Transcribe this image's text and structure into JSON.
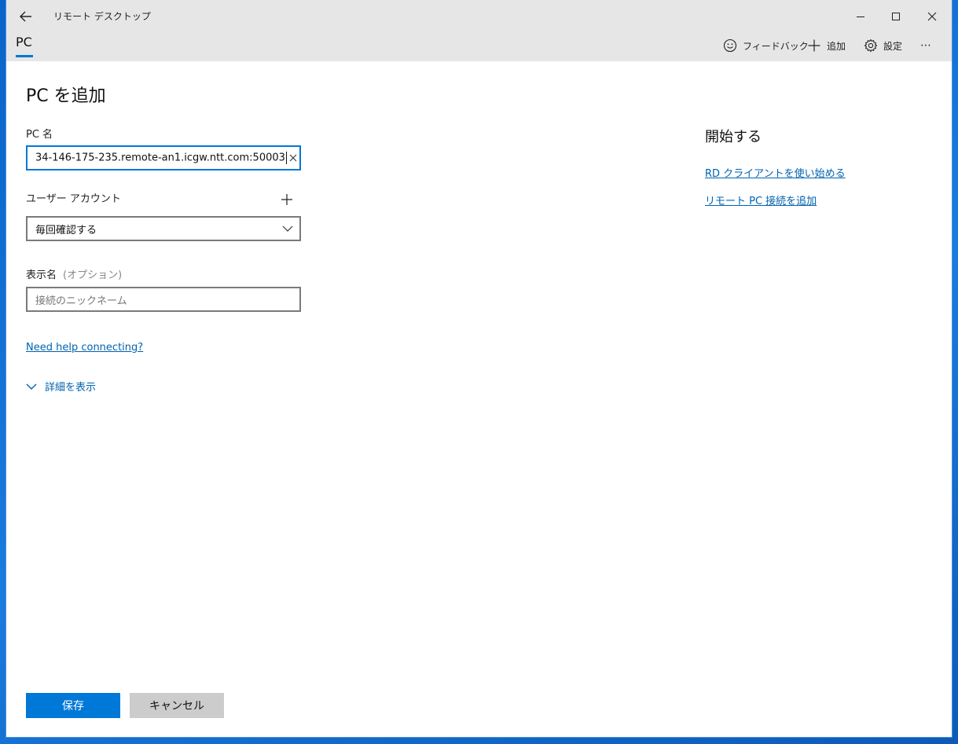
{
  "window": {
    "title": "リモート デスクトップ",
    "controls": [
      "minimize-icon",
      "maximize-icon",
      "close-icon"
    ]
  },
  "nav": {
    "tab_label": "PC",
    "commands": [
      {
        "icon": "smiley-icon",
        "label": "フィードバック"
      },
      {
        "icon": "plus-icon",
        "label": "追加"
      },
      {
        "icon": "gear-icon",
        "label": "設定"
      },
      {
        "icon": "more-icon",
        "label": "⋯"
      }
    ]
  },
  "form": {
    "title": "PC を追加",
    "pc_name": {
      "label": "PC 名",
      "value": "34-146-175-235.remote-an1.icgw.ntt.com:50003"
    },
    "user_account": {
      "label": "ユーザー アカウント",
      "selected": "毎回確認する"
    },
    "display_name": {
      "label": "表示名",
      "optional": "(オプション)",
      "placeholder": "接続のニックネーム"
    },
    "help_link": "Need help connecting?",
    "details_toggle": "詳細を表示",
    "save_label": "保存",
    "cancel_label": "キャンセル"
  },
  "sidebar": {
    "title": "開始する",
    "links": [
      "RD クライアントを使い始める",
      "リモート PC 接続を追加"
    ]
  },
  "colors": {
    "accent": "#0078d7",
    "link": "#0063b1",
    "titlebar": "#e6e6e6",
    "desktop": "#0b5fc2"
  }
}
